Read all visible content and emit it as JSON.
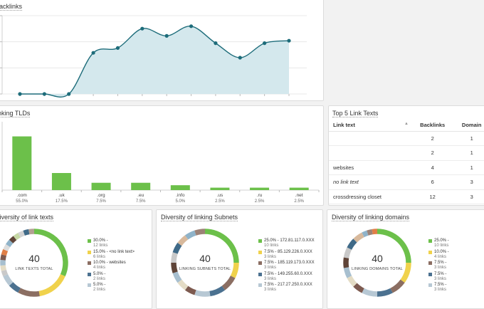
{
  "backlinks": {
    "title": "Backlinks",
    "chart_data": {
      "type": "area",
      "title": "Backlinks",
      "x": [
        0,
        1,
        2,
        3,
        4,
        5,
        6,
        7,
        8,
        9,
        10,
        11
      ],
      "values": [
        0,
        0,
        0,
        17,
        19,
        27,
        24,
        28,
        21,
        15,
        21,
        22
      ],
      "ylim": [
        0,
        30
      ],
      "grid": true,
      "colors": {
        "line": "#1d6c7a",
        "fill": "#d4e8ed",
        "point": "#1d6c7a"
      }
    }
  },
  "tlds": {
    "title": "linking TLDs",
    "chart_data": {
      "type": "bar",
      "categories": [
        ".com",
        ".uk",
        ".org",
        ".eu",
        ".info",
        ".us",
        ".ru",
        ".net"
      ],
      "percent_labels": [
        "55.0%",
        "17.5%",
        "7.5%",
        "7.5%",
        "5.0%",
        "2.5%",
        "2.5%",
        "2.5%"
      ],
      "values": [
        55.0,
        17.5,
        7.5,
        7.5,
        5.0,
        2.5,
        2.5,
        2.5
      ],
      "ylim": [
        0,
        70
      ],
      "color": "#6cc04a"
    }
  },
  "link_texts": {
    "title": "Top 5 Link Texts",
    "columns": [
      "Link text",
      "Backlinks",
      "Domain"
    ],
    "rows": [
      {
        "text": "",
        "backlinks": "2",
        "domain": "1",
        "italic": false
      },
      {
        "text": "",
        "backlinks": "2",
        "domain": "1",
        "italic": false
      },
      {
        "text": "websites",
        "backlinks": "4",
        "domain": "1",
        "italic": false
      },
      {
        "text": "no link text",
        "backlinks": "6",
        "domain": "3",
        "italic": true
      },
      {
        "text": "crossdressing closet",
        "backlinks": "12",
        "domain": "3",
        "italic": false
      }
    ]
  },
  "diversity": [
    {
      "title": "Diversity of link texts",
      "total": "40",
      "total_label": "LINK TEXTS TOTAL",
      "legend": [
        {
          "main": "30.0% -",
          "sub": "12 links",
          "color": "#6cc04a"
        },
        {
          "main": "15.0% - <no link text>",
          "sub": "6 links",
          "color": "#f0d24c"
        },
        {
          "main": "10.0% - websites",
          "sub": "4 links",
          "color": "#8b6e62"
        },
        {
          "main": "5.0% -",
          "sub": "2 links",
          "color": "#4b7190"
        },
        {
          "main": "5.0% -",
          "sub": "2 links",
          "color": "#b7c8d4"
        }
      ],
      "chart_data": {
        "type": "pie",
        "values": [
          30,
          15,
          10,
          5,
          5,
          2.5,
          2.5,
          2.5,
          2.5,
          2.5,
          2.5,
          2.5,
          2.5,
          2.5,
          2.5,
          2.5,
          2.5
        ],
        "colors": [
          "#6cc04a",
          "#f0d24c",
          "#8b6e62",
          "#4b7190",
          "#b7c8d4",
          "#c9c9c9",
          "#e4dcc5",
          "#a7bfcf",
          "#7d5a4f",
          "#e07f47",
          "#dddddd",
          "#8fb3c9",
          "#5f4438",
          "#c6d8a5",
          "#d2d2d2",
          "#3f6a88",
          "#b3a093"
        ]
      }
    },
    {
      "title": "Diversity of linking Subnets",
      "total": "40",
      "total_label": "LINKING SUBNETS TOTAL",
      "legend": [
        {
          "main": "25.0% - 172.81.117.0.XXX",
          "sub": "10 links",
          "color": "#6cc04a"
        },
        {
          "main": "7.5% - 85.129.226.0.XXX",
          "sub": "3 links",
          "color": "#f0d24c"
        },
        {
          "main": "7.5% - 185.119.173.0.XXX",
          "sub": "3 links",
          "color": "#8b6e62"
        },
        {
          "main": "7.5% - 149.255.60.0.XXX",
          "sub": "3 links",
          "color": "#4b7190"
        },
        {
          "main": "7.5% - 217.27.250.0.XXX",
          "sub": "3 links",
          "color": "#b7c8d4"
        }
      ],
      "chart_data": {
        "type": "pie",
        "values": [
          25,
          7.5,
          7.5,
          7.5,
          7.5,
          5,
          5,
          5,
          5,
          5,
          5,
          5,
          5,
          5
        ],
        "colors": [
          "#6cc04a",
          "#f0d24c",
          "#8b6e62",
          "#4b7190",
          "#b7c8d4",
          "#7d5a4f",
          "#e4dcc5",
          "#a7bfcf",
          "#5f4438",
          "#c9c9c9",
          "#3f6a88",
          "#d8b99c",
          "#8fb3c9",
          "#9c8277"
        ]
      }
    },
    {
      "title": "Diversity of linking domains",
      "total": "40",
      "total_label": "LINKING DOMAINS TOTAL",
      "legend": [
        {
          "main": "25.0% -",
          "sub": "10 links",
          "color": "#6cc04a"
        },
        {
          "main": "10.0% -",
          "sub": "4 links",
          "color": "#f0d24c"
        },
        {
          "main": "7.5% -",
          "sub": "3 links",
          "color": "#8b6e62"
        },
        {
          "main": "7.5% -",
          "sub": "3 links",
          "color": "#4b7190"
        },
        {
          "main": "7.5% -",
          "sub": "3 links",
          "color": "#b7c8d4"
        }
      ],
      "chart_data": {
        "type": "pie",
        "values": [
          25,
          10,
          7.5,
          7.5,
          7.5,
          5,
          5,
          5,
          5,
          5,
          5,
          5,
          2.5,
          2.5,
          2.5
        ],
        "colors": [
          "#6cc04a",
          "#f0d24c",
          "#8b6e62",
          "#4b7190",
          "#b7c8d4",
          "#7d5a4f",
          "#e4dcc5",
          "#a7bfcf",
          "#5f4438",
          "#c9c9c9",
          "#3f6a88",
          "#d8b99c",
          "#8fb3c9",
          "#9c8277",
          "#e07f47"
        ]
      }
    }
  ]
}
